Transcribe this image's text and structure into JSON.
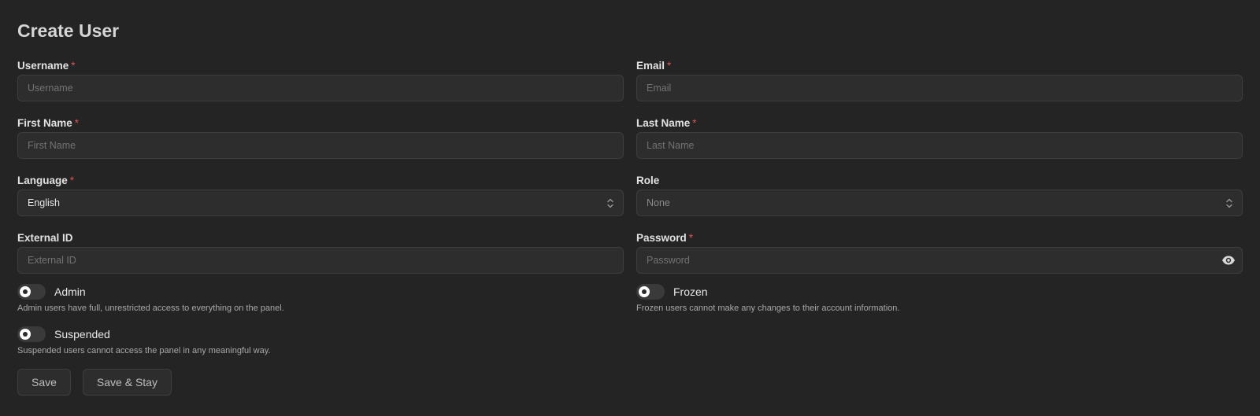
{
  "page": {
    "title": "Create User"
  },
  "fields": {
    "username": {
      "label": "Username",
      "required_mark": "*",
      "placeholder": "Username",
      "value": ""
    },
    "email": {
      "label": "Email",
      "required_mark": "*",
      "placeholder": "Email",
      "value": ""
    },
    "first_name": {
      "label": "First Name",
      "required_mark": "*",
      "placeholder": "First Name",
      "value": ""
    },
    "last_name": {
      "label": "Last Name",
      "required_mark": "*",
      "placeholder": "Last Name",
      "value": ""
    },
    "language": {
      "label": "Language",
      "required_mark": "*",
      "selected": "English"
    },
    "role": {
      "label": "Role",
      "selected": "None"
    },
    "external_id": {
      "label": "External ID",
      "placeholder": "External ID",
      "value": ""
    },
    "password": {
      "label": "Password",
      "required_mark": "*",
      "placeholder": "Password",
      "value": ""
    }
  },
  "toggles": {
    "admin": {
      "label": "Admin",
      "description": "Admin users have full, unrestricted access to everything on the panel.",
      "checked": false
    },
    "frozen": {
      "label": "Frozen",
      "description": "Frozen users cannot make any changes to their account information.",
      "checked": false
    },
    "suspended": {
      "label": "Suspended",
      "description": "Suspended users cannot access the panel in any meaningful way.",
      "checked": false
    }
  },
  "actions": {
    "save_label": "Save",
    "save_stay_label": "Save & Stay"
  },
  "icons": {
    "select": "chevron-updown-icon",
    "password": "eye-icon"
  },
  "colors": {
    "background": "#242424",
    "input_bg": "#2d2d2d",
    "required": "#e05050"
  }
}
